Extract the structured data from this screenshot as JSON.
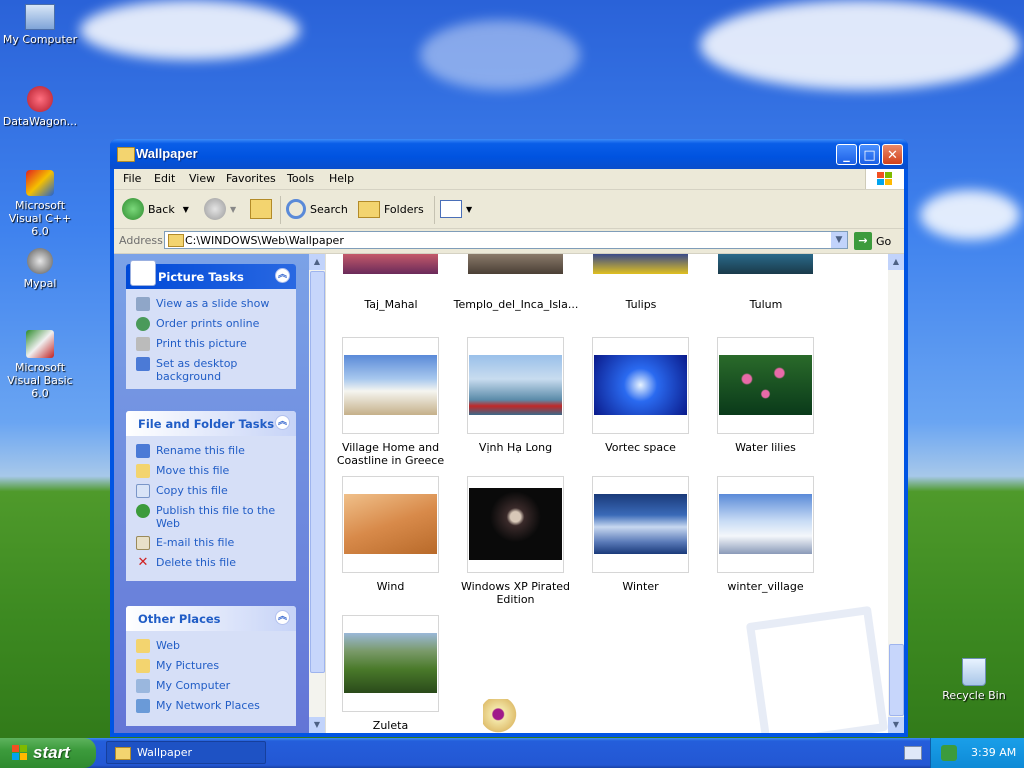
{
  "desktop": {
    "icons": [
      {
        "label": "My Computer"
      },
      {
        "label": "DataWagon..."
      },
      {
        "label": "Microsoft Visual C++ 6.0"
      },
      {
        "label": "Mypal"
      },
      {
        "label": "Microsoft Visual Basic 6.0"
      },
      {
        "label": "Recycle Bin"
      }
    ]
  },
  "window": {
    "title": "Wallpaper",
    "menu": [
      "File",
      "Edit",
      "View",
      "Favorites",
      "Tools",
      "Help"
    ],
    "toolbar": {
      "back": "Back",
      "search": "Search",
      "folders": "Folders"
    },
    "address": {
      "label": "Address",
      "value": "C:\\WINDOWS\\Web\\Wallpaper",
      "go": "Go"
    }
  },
  "leftpane": {
    "picture_tasks": {
      "title": "Picture Tasks",
      "items": [
        "View as a slide show",
        "Order prints online",
        "Print this picture",
        "Set as desktop background"
      ]
    },
    "file_tasks": {
      "title": "File and Folder Tasks",
      "items": [
        "Rename this file",
        "Move this file",
        "Copy this file",
        "Publish this file to the Web",
        "E-mail this file",
        "Delete this file"
      ]
    },
    "other_places": {
      "title": "Other Places",
      "items": [
        "Web",
        "My Pictures",
        "My Computer",
        "My Network Places"
      ]
    }
  },
  "files": [
    {
      "name": "Taj_Mahal"
    },
    {
      "name": "Templo_del_Inca_Isla..."
    },
    {
      "name": "Tulips"
    },
    {
      "name": "Tulum"
    },
    {
      "name": "Village Home and Coastline in Greece"
    },
    {
      "name": "Vịnh Hạ Long"
    },
    {
      "name": "Vortec space"
    },
    {
      "name": "Water lilies"
    },
    {
      "name": "Wind"
    },
    {
      "name": "Windows XP Pirated Edition"
    },
    {
      "name": "Winter"
    },
    {
      "name": "winter_village"
    },
    {
      "name": "Zuleta"
    }
  ],
  "taskbar": {
    "start": "start",
    "task": "Wallpaper",
    "clock": "3:39 AM"
  }
}
